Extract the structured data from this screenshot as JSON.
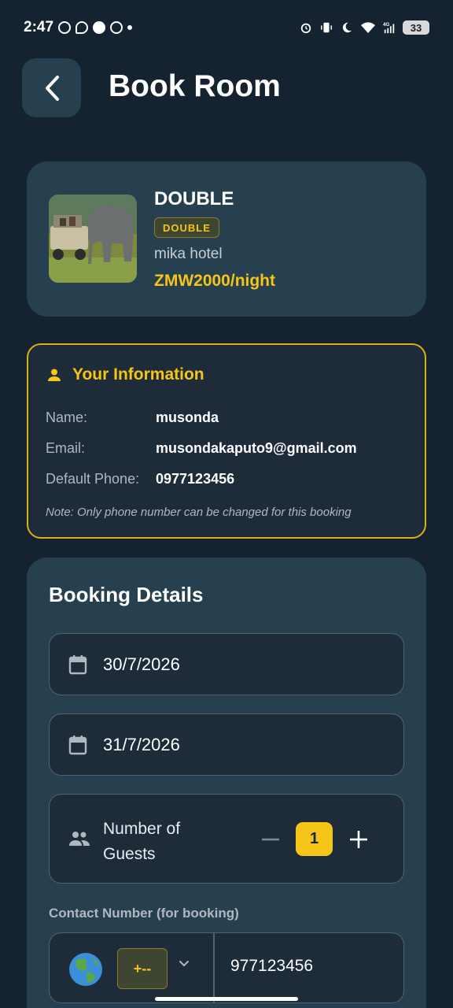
{
  "status_bar": {
    "time": "2:47",
    "battery": "33",
    "icons": [
      "whatsapp-icon",
      "chat-icon",
      "facebook-icon",
      "whatsapp-icon",
      "dot-icon",
      "alarm-icon",
      "vibrate-icon",
      "moon-icon",
      "wifi-icon",
      "signal-4g-icon",
      "battery-icon"
    ]
  },
  "header": {
    "title": "Book Room",
    "back_icon": "chevron-left-icon"
  },
  "room": {
    "name": "DOUBLE",
    "type_badge": "DOUBLE",
    "hotel": "mika hotel",
    "price": "ZMW2000/night",
    "thumbnail": "room-thumbnail-image"
  },
  "info": {
    "title": "Your Information",
    "icon": "person-icon",
    "name_label": "Name:",
    "name_value": "musonda",
    "email_label": "Email:",
    "email_value": "musondakaputo9@gmail.com",
    "phone_label": "Default Phone:",
    "phone_value": "0977123456",
    "note": "Note: Only phone number can be changed for this booking"
  },
  "booking": {
    "title": "Booking Details",
    "check_in": "30/7/2026",
    "check_out": "31/7/2026",
    "guests_label": "Number of Guests",
    "guests_count": "1",
    "contact_label": "Contact Number (for booking)",
    "country_code": "+--",
    "phone_number": "977123456"
  },
  "colors": {
    "background": "#14232f",
    "card": "#26404f",
    "accent": "#f5c518"
  }
}
